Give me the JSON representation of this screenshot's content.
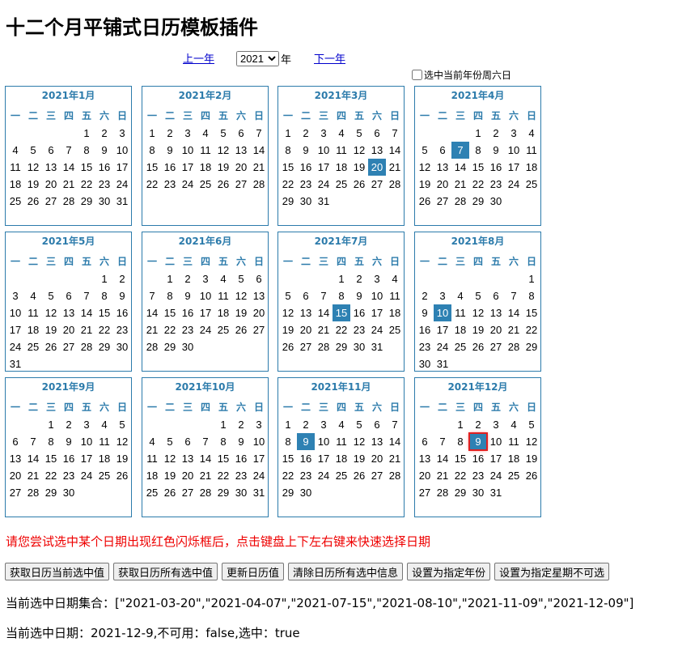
{
  "page_title": "十二个月平铺式日历模板插件",
  "nav": {
    "prev_label": "上一年",
    "next_label": "下一年",
    "year_value": "2021",
    "year_suffix": "年"
  },
  "weekend_checkbox_label": "选中当前年份周六日",
  "weekday_headers": [
    "一",
    "二",
    "三",
    "四",
    "五",
    "六",
    "日"
  ],
  "months": [
    {
      "title": "2021年1月",
      "offset": 4,
      "days": 31,
      "selected": []
    },
    {
      "title": "2021年2月",
      "offset": 0,
      "days": 28,
      "selected": []
    },
    {
      "title": "2021年3月",
      "offset": 0,
      "days": 31,
      "selected": [
        20
      ]
    },
    {
      "title": "2021年4月",
      "offset": 3,
      "days": 30,
      "selected": [
        7
      ]
    },
    {
      "title": "2021年5月",
      "offset": 5,
      "days": 31,
      "selected": []
    },
    {
      "title": "2021年6月",
      "offset": 1,
      "days": 30,
      "selected": []
    },
    {
      "title": "2021年7月",
      "offset": 3,
      "days": 31,
      "selected": [
        15
      ]
    },
    {
      "title": "2021年8月",
      "offset": 6,
      "days": 31,
      "selected": [
        10
      ]
    },
    {
      "title": "2021年9月",
      "offset": 2,
      "days": 30,
      "selected": []
    },
    {
      "title": "2021年10月",
      "offset": 4,
      "days": 31,
      "selected": []
    },
    {
      "title": "2021年11月",
      "offset": 0,
      "days": 30,
      "selected": [
        9
      ]
    },
    {
      "title": "2021年12月",
      "offset": 2,
      "days": 31,
      "selected": [
        9
      ],
      "focused": 9
    }
  ],
  "hint_text": "请您尝试选中某个日期出现红色闪烁框后，点击键盘上下左右键来快速选择日期",
  "buttons": [
    "获取日历当前选中值",
    "获取日历所有选中值",
    "更新日历值",
    "清除日历所有选中信息",
    "设置为指定年份",
    "设置为指定星期不可选"
  ],
  "selected_set_text": "当前选中日期集合：[\"2021-03-20\",\"2021-04-07\",\"2021-07-15\",\"2021-08-10\",\"2021-11-09\",\"2021-12-09\"]",
  "current_selected_text": "当前选中日期：2021-12-9,不可用：false,选中：true",
  "colors": {
    "accent": "#2c7bab",
    "selected_bg": "#2e81b3",
    "focus_border": "#e02020",
    "hint": "#ee0000"
  }
}
